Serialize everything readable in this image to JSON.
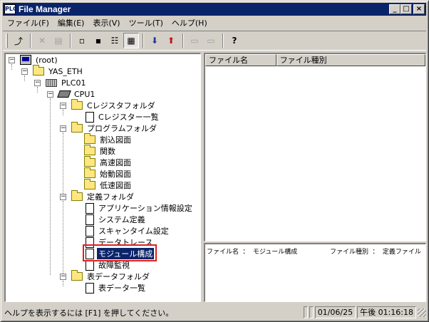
{
  "window": {
    "title": "File Manager",
    "app_icon_text": "PLC",
    "controls": {
      "minimize": "_",
      "maximize": "□",
      "close": "×"
    }
  },
  "menu": [
    "ファイル(F)",
    "編集(E)",
    "表示(V)",
    "ツール(T)",
    "ヘルプ(H)"
  ],
  "toolbar": {
    "tools": [
      {
        "name": "up-folder-icon",
        "glyph": "⤴",
        "state": "normal"
      },
      {
        "name": "delete-icon",
        "glyph": "✕",
        "state": "disabled"
      },
      {
        "name": "properties-icon",
        "glyph": "▤",
        "state": "disabled"
      },
      {
        "name": "large-icons-icon",
        "glyph": "▫",
        "state": "normal"
      },
      {
        "name": "small-icons-icon",
        "glyph": "▪",
        "state": "normal"
      },
      {
        "name": "list-view-icon",
        "glyph": "☷",
        "state": "normal"
      },
      {
        "name": "details-view-icon",
        "glyph": "▦",
        "state": "pressed"
      },
      {
        "name": "download-icon",
        "glyph": "⬇",
        "state": "normal"
      },
      {
        "name": "upload-icon",
        "glyph": "⬆",
        "state": "normal"
      },
      {
        "name": "link-1-icon",
        "glyph": "▭",
        "state": "disabled"
      },
      {
        "name": "link-2-icon",
        "glyph": "▭",
        "state": "disabled"
      },
      {
        "name": "help-icon",
        "glyph": "?",
        "state": "normal"
      }
    ]
  },
  "tree": [
    {
      "label": "(root)",
      "icon": "root",
      "level": 0,
      "expander": "−"
    },
    {
      "label": "YAS_ETH",
      "icon": "folder",
      "level": 1,
      "expander": "−"
    },
    {
      "label": "PLC01",
      "icon": "plc",
      "level": 2,
      "expander": "−"
    },
    {
      "label": "CPU1",
      "icon": "cpu",
      "level": 3,
      "expander": "−"
    },
    {
      "label": "Cレジスタフォルダ",
      "icon": "folder",
      "level": 4,
      "expander": "−"
    },
    {
      "label": "Cレジスター一覧",
      "icon": "doc",
      "level": 5,
      "expander": ""
    },
    {
      "label": "プログラムフォルダ",
      "icon": "folder",
      "level": 4,
      "expander": "−"
    },
    {
      "label": "割込図面",
      "icon": "folder",
      "level": 5,
      "expander": ""
    },
    {
      "label": "関数",
      "icon": "folder",
      "level": 5,
      "expander": ""
    },
    {
      "label": "高速図面",
      "icon": "folder",
      "level": 5,
      "expander": ""
    },
    {
      "label": "始動図面",
      "icon": "folder",
      "level": 5,
      "expander": ""
    },
    {
      "label": "低速図面",
      "icon": "folder",
      "level": 5,
      "expander": ""
    },
    {
      "label": "定義フォルダ",
      "icon": "folder",
      "level": 4,
      "expander": "−"
    },
    {
      "label": "アプリケーション情報設定",
      "icon": "doc",
      "level": 5,
      "expander": ""
    },
    {
      "label": "システム定義",
      "icon": "doc",
      "level": 5,
      "expander": ""
    },
    {
      "label": "スキャンタイム設定",
      "icon": "doc",
      "level": 5,
      "expander": ""
    },
    {
      "label": "データトレース",
      "icon": "doc",
      "level": 5,
      "expander": ""
    },
    {
      "label": "モジュール構成",
      "icon": "doc",
      "level": 5,
      "expander": "",
      "selected": true
    },
    {
      "label": "故障監視",
      "icon": "doc",
      "level": 5,
      "expander": ""
    },
    {
      "label": "表データフォルダ",
      "icon": "folder",
      "level": 4,
      "expander": "−"
    },
    {
      "label": "表データ一覧",
      "icon": "doc",
      "level": 5,
      "expander": ""
    }
  ],
  "file_list": {
    "columns": [
      "ファイル名",
      "ファイル種別"
    ]
  },
  "info": {
    "filename_label": "ファイル名 ： モジュール構成",
    "filetype_label": "ファイル種別 ： 定義ファイル"
  },
  "status": {
    "help_text": "ヘルプを表示するには [F1] を押してください。",
    "date": "01/06/25",
    "time": "午後 01:16:18"
  },
  "colors": {
    "titlebar": "#0a246a",
    "selection": "#0a246a",
    "highlight_box": "#e02020"
  }
}
